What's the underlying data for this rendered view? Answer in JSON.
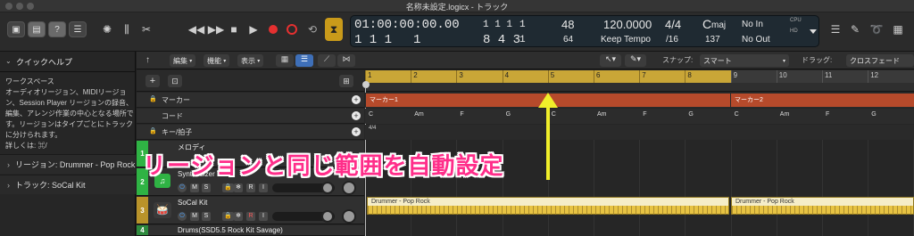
{
  "window": {
    "title": "名称未設定.logicx - トラック"
  },
  "lcd": {
    "position_time": "01:00:00:00.00",
    "position_sub_top": "1 1 1",
    "position_sub_top2": "1",
    "position_bars": "1  1  1",
    "position_bars2": "1",
    "position_right": "8  4  3",
    "position_right2": "1",
    "number_48": "48",
    "number_64": "64",
    "tempo": "120.0000",
    "tempo_mode": "Keep Tempo",
    "time_sig": "4/4",
    "division": "/16",
    "key_letter": "C",
    "key_mode": "maj",
    "key_value": "137",
    "midi_in": "No In",
    "midi_out": "No Out",
    "cpu_label": "CPU",
    "hd_label": "HD"
  },
  "quick_help": {
    "title": "クイックヘルプ",
    "heading": "ワークスペース",
    "body": "オーディオリージョン、MIDIリージョン、Session Player リージョンの録音、編集、アレンジ作業の中心となる場所です。リージョンはタイプごとにトラックに分けられます。",
    "shortcut": "詳しくは: ⌘/"
  },
  "inspector": {
    "region": "リージョン: Drummer - Pop Rock",
    "track": "トラック: SoCal Kit"
  },
  "toolbar": {
    "edit": "編集",
    "function": "機能",
    "view": "表示",
    "snap_label": "スナップ:",
    "snap_value": "スマート",
    "drag_label": "ドラッグ:",
    "drag_value": "クロスフェード"
  },
  "global_tracks": {
    "marker": "マーカー",
    "chord": "コード",
    "key_sig": "キー/拍子"
  },
  "ruler": {
    "bars": [
      "1",
      "2",
      "3",
      "4",
      "5",
      "6",
      "7",
      "8",
      "9",
      "10",
      "11",
      "12"
    ]
  },
  "markers": [
    "マーカー1",
    "マーカー2"
  ],
  "chords": [
    "C",
    "Am",
    "F",
    "G",
    "C",
    "Am",
    "F",
    "G",
    "C",
    "Am",
    "F",
    "G"
  ],
  "time_signature_row": "4/4",
  "tracks": [
    {
      "number": "1",
      "name": "メロディ"
    },
    {
      "number": "2",
      "name": "Synthesizer V"
    },
    {
      "number": "3",
      "name": "SoCal Kit"
    },
    {
      "number": "4",
      "name": "Drums(SSD5.5 Rock Kit Savage)"
    }
  ],
  "track_buttons": {
    "power": "⏻",
    "mute": "M",
    "solo": "S",
    "lock": "🔒",
    "freeze": "❄",
    "rec": "R",
    "input": "I"
  },
  "regions": [
    "Drummer - Pop Rock",
    "Drummer - Pop Rock"
  ],
  "annotation": "リージョンと同じ範囲を自動設定",
  "colors": {
    "ruler_cycle": "#c9a637",
    "marker": "#b64a2b",
    "drummer_region": "#e7c343",
    "annotation_text": "#ff2e8a",
    "arrow": "#f0ee2a",
    "track_green": "#2fb344"
  }
}
